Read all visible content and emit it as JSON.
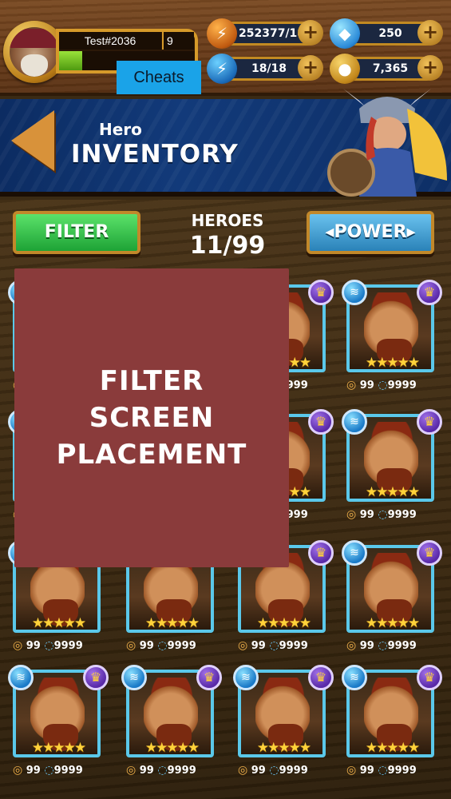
{
  "player": {
    "name": "Test#2036",
    "level": "9",
    "xp_fraction": 0.17
  },
  "cheats_label": "Cheats",
  "resources": {
    "energy": {
      "value": "252377/18",
      "icon": "lightning-orange-icon"
    },
    "stamina": {
      "value": "18/18",
      "icon": "lightning-blue-icon"
    },
    "gems": {
      "value": "250",
      "icon": "gem-icon"
    },
    "gold": {
      "value": "7,365",
      "icon": "gold-coin-icon"
    }
  },
  "header": {
    "subtitle": "Hero",
    "title": "INVENTORY"
  },
  "toolbar": {
    "filter_label": "FILTER",
    "power_label": "◂POWER▸",
    "heroes_label": "HEROES",
    "heroes_count": "11/99"
  },
  "overlay": {
    "lines": [
      "FILTER",
      "SCREEN",
      "PLACEMENT"
    ]
  },
  "hero_card": {
    "stars": "★★★★★",
    "level": "99",
    "power": "9999",
    "element_icon": "water-element-icon",
    "rank_icon": "crown-icon"
  },
  "colors": {
    "filter_green": "#1ea336",
    "power_blue": "#2a82b8",
    "overlay": "#8a3b3b",
    "cheats": "#1aa3e8"
  }
}
